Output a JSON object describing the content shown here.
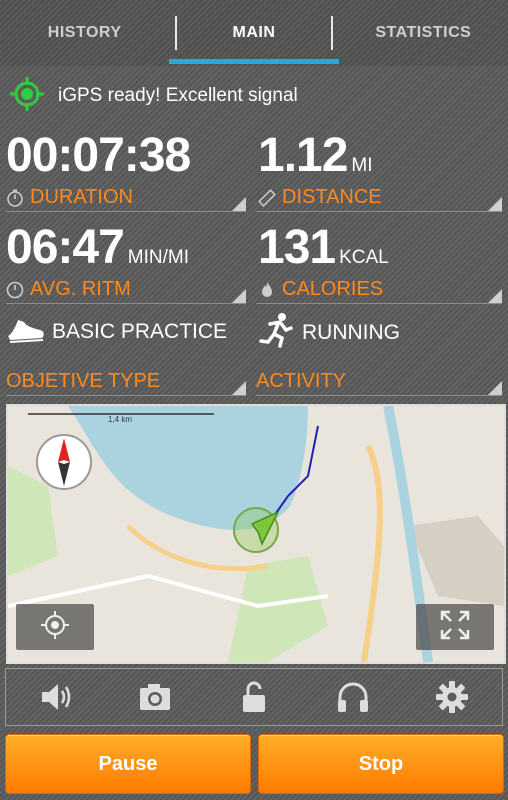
{
  "tabs": {
    "history": "HISTORY",
    "main": "MAIN",
    "statistics": "STATISTICS"
  },
  "gps": {
    "status": "iGPS ready! Excellent signal"
  },
  "stats": {
    "duration": {
      "value": "00:07:38",
      "unit": "",
      "label": "DURATION"
    },
    "distance": {
      "value": "1.12",
      "unit": "MI",
      "label": "DISTANCE"
    },
    "pace": {
      "value": "06:47",
      "unit": "MIN/MI",
      "label": "AVG. RITM"
    },
    "calories": {
      "value": "131",
      "unit": "KCAL",
      "label": "CALORIES"
    }
  },
  "workout": {
    "objective_value": "BASIC PRACTICE",
    "objective_label": "OBJETIVE TYPE",
    "activity_value": "RUNNING",
    "activity_label": "ACTIVITY"
  },
  "map": {
    "scale": "1,4 km"
  },
  "toolbar": {
    "icons": [
      "volume-icon",
      "camera-icon",
      "lock-icon",
      "headphones-icon",
      "settings-icon"
    ]
  },
  "buttons": {
    "pause": "Pause",
    "stop": "Stop"
  },
  "colors": {
    "accent": "#ff8a1d",
    "tab_indicator": "#29a7e1",
    "gps_green": "#2ecc40"
  }
}
